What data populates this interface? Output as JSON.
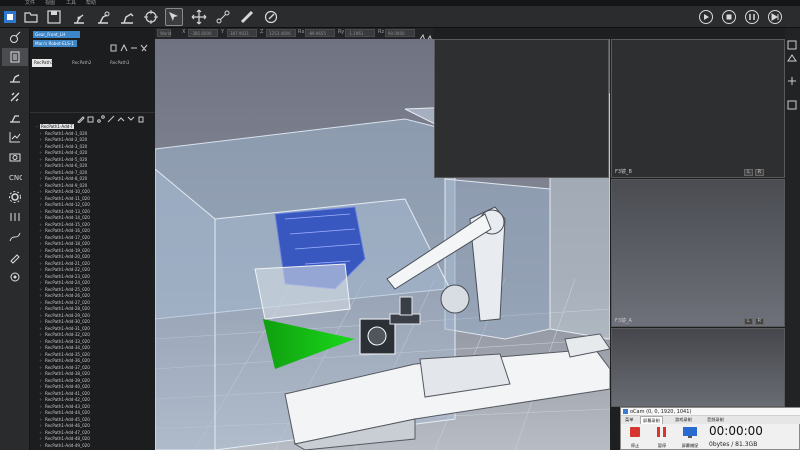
{
  "menubar": [
    "文件",
    "视图",
    "工具",
    "帮助"
  ],
  "toolbar_icons": [
    "app-logo-icon",
    "open-folder-icon",
    "save-icon",
    "robot-arm-icon",
    "robot-joint-icon",
    "robot-arm-tool-icon",
    "select-arrow-icon",
    "move-icon",
    "connect-icon",
    "measure-icon",
    "record-icon"
  ],
  "run_controls": [
    "play-icon",
    "stop-icon",
    "pause-icon",
    "end-icon"
  ],
  "coords": {
    "field0": "World",
    "x_label": "X",
    "x_value": "-385.6000",
    "y_label": "Y",
    "y_value": "387.9021",
    "z_label": "Z",
    "z_value": "1253.4006",
    "rx_label": "Rx",
    "rx_value": "-89.9655",
    "ry_label": "Ry",
    "ry_value": "-1.1961",
    "rz_label": "Rz",
    "rz_value": "90.0000"
  },
  "left_panel": {
    "selected1": "Gear_Front_LH",
    "selected2": "Man's Robot-ELS-1",
    "tabs": [
      "RecPath1",
      "RecPath2",
      "RecPath3"
    ],
    "root": "RecPath1-Add-T",
    "items": [
      "RecPath1-Add-1_020",
      "RecPath1-Add-2_020",
      "RecPath1-Add-3_020",
      "RecPath1-Add-4_020",
      "RecPath1-Add-5_020",
      "RecPath1-Add-6_020",
      "RecPath1-Add-7_020",
      "RecPath1-Add-8_020",
      "RecPath1-Add-9_020",
      "RecPath1-Add-10_020",
      "RecPath1-Add-11_020",
      "RecPath1-Add-12_020",
      "RecPath1-Add-13_020",
      "RecPath1-Add-14_020",
      "RecPath1-Add-15_020",
      "RecPath1-Add-16_020",
      "RecPath1-Add-17_020",
      "RecPath1-Add-18_020",
      "RecPath1-Add-19_020",
      "RecPath1-Add-20_020",
      "RecPath1-Add-21_020",
      "RecPath1-Add-22_020",
      "RecPath1-Add-23_020",
      "RecPath1-Add-24_020",
      "RecPath1-Add-25_020",
      "RecPath1-Add-26_020",
      "RecPath1-Add-27_020",
      "RecPath1-Add-28_020",
      "RecPath1-Add-29_020",
      "RecPath1-Add-30_020",
      "RecPath1-Add-31_020",
      "RecPath1-Add-32_020",
      "RecPath1-Add-33_020",
      "RecPath1-Add-34_020",
      "RecPath1-Add-35_020",
      "RecPath1-Add-36_020",
      "RecPath1-Add-37_020",
      "RecPath1-Add-38_020",
      "RecPath1-Add-39_020",
      "RecPath1-Add-40_020",
      "RecPath1-Add-41_020",
      "RecPath1-Add-42_020",
      "RecPath1-Add-43_020",
      "RecPath1-Add-44_020",
      "RecPath1-Add-45_020",
      "RecPath1-Add-46_020",
      "RecPath1-Add-47_020",
      "RecPath1-Add-48_020",
      "RecPath1-Add-49_020"
    ]
  },
  "cameras": [
    {
      "title": ""
    },
    {
      "title": "F3镜_B",
      "l": "L",
      "r": "R"
    },
    {
      "title": "F3镜_A",
      "l": "L",
      "r": "R"
    },
    {
      "title": ""
    }
  ],
  "ocam": {
    "title": "oCam (0, 0, 1920, 1041)",
    "tabs": [
      "菜单",
      "屏幕录制",
      "游戏录制",
      "音频录制"
    ],
    "stop": "停止",
    "pause": "暂停",
    "region": "屏幕捕捉",
    "time": "00:00:00",
    "size": "0bytes / 81.3GB"
  },
  "colors": {
    "accent": "#3d86c8",
    "viewport_bg": "#7c8190",
    "camera_cone": "#22c322"
  }
}
